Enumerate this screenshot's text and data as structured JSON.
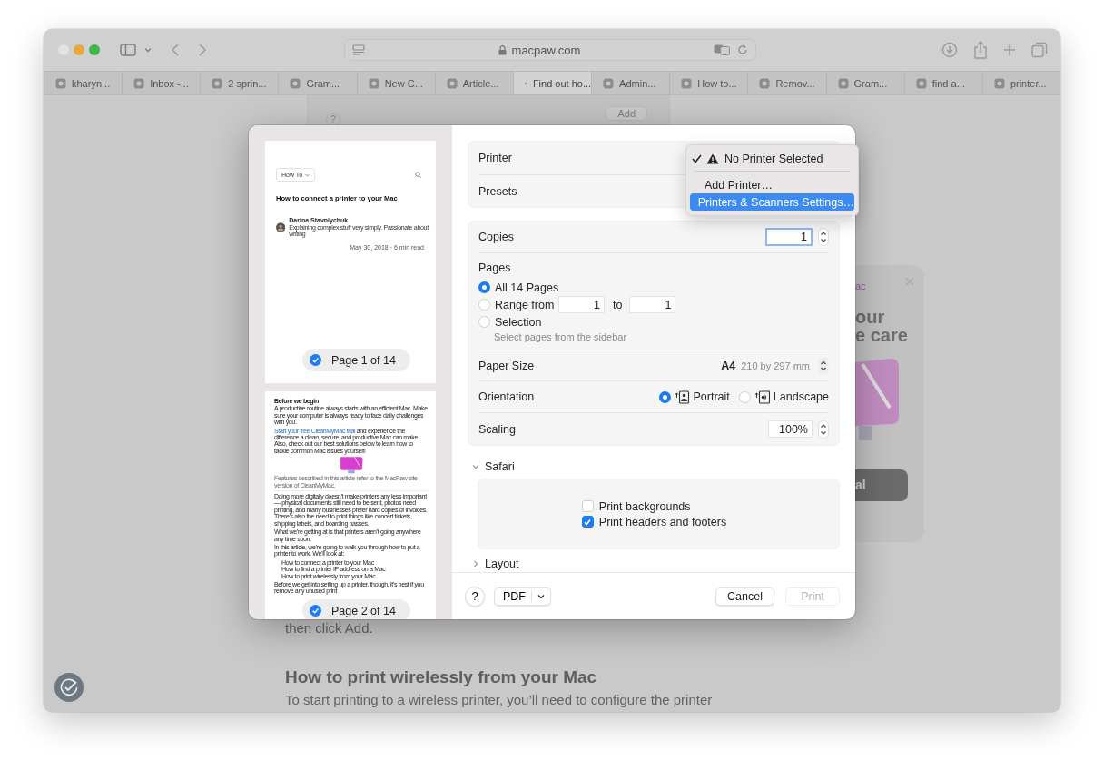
{
  "browser": {
    "address": "macpaw.com",
    "tabs": [
      {
        "label": "kharyn...",
        "selected": false
      },
      {
        "label": "Inbox -...",
        "selected": false
      },
      {
        "label": "2 sprin...",
        "selected": false
      },
      {
        "label": "Gram...",
        "selected": false
      },
      {
        "label": "New C...",
        "selected": false
      },
      {
        "label": "Article...",
        "selected": false
      },
      {
        "label": "Find out ho...",
        "selected": true
      },
      {
        "label": "Admin...",
        "selected": false
      },
      {
        "label": "How to...",
        "selected": false
      },
      {
        "label": "Remov...",
        "selected": false
      },
      {
        "label": "Gram...",
        "selected": false
      },
      {
        "label": "find a...",
        "selected": false
      },
      {
        "label": "printer...",
        "selected": false
      }
    ]
  },
  "background_page": {
    "sheet_help": "?",
    "sheet_button": "Add",
    "promo": {
      "label": "ac",
      "title_lines": [
        "our",
        "e care"
      ],
      "button": "al"
    },
    "text": "then click Add.",
    "heading": "How to print wirelessly from your Mac",
    "paragraph": "To start printing to a wireless printer, you’ll need to configure the printer"
  },
  "print_dialog": {
    "previews": [
      {
        "kind": "cover",
        "selected": true,
        "page_label": "Page 1 of 14",
        "nav_label": "How To",
        "title": "How to connect a printer to your Mac",
        "author": "Darina Stavniychuk",
        "bio": "Explaining complex stuff very simply. Passionate about writing",
        "date": "May 30, 2018 · 6 min read"
      },
      {
        "kind": "body",
        "selected": true,
        "page_label": "Page 2 of 14",
        "blocks": [
          {
            "kind": "heading",
            "text": "Before we begin"
          },
          {
            "kind": "text",
            "text": "A productive routine always starts with an efficient Mac. Make sure your computer is always ready to face daily challenges with you."
          },
          {
            "kind": "link_text",
            "link": "Start your free CleanMyMac trial",
            "text": " and experience the difference a clean, secure, and productive Mac can make. Also, check out our best solutions below to learn how to tackle common Mac issues yourself!"
          },
          {
            "kind": "illustration"
          },
          {
            "kind": "note",
            "text": "Features described in this article refer to the MacPaw site version of CleanMyMac."
          },
          {
            "kind": "text",
            "text": "Doing more digitally doesn’t make printers any less important — physical documents still need to be sent, photos need printing, and many businesses prefer hard copies of invoices. There’s also the need to print things like concert tickets, shipping labels, and boarding passes."
          },
          {
            "kind": "text",
            "text": "What we’re getting at is that printers aren’t going anywhere any time soon."
          },
          {
            "kind": "text",
            "text": "In this article, we’re going to walk you through how to put a printer to work. We’ll look at:"
          },
          {
            "kind": "list",
            "items": [
              "How to connect a printer to your Mac",
              "How to find a printer IP address on a Mac",
              "How to print wirelessly from your Mac"
            ]
          },
          {
            "kind": "text",
            "text": "Before we get into setting up a printer, though, it’s best if you remove any unused print"
          }
        ]
      }
    ],
    "printer_label": "Printer",
    "presets_label": "Presets",
    "printer_menu": [
      {
        "label": "No Printer Selected",
        "checked": true,
        "warning": true,
        "selected": false
      },
      {
        "label": "Add Printer…",
        "checked": false,
        "warning": false,
        "selected": false
      },
      {
        "label": "Printers & Scanners Settings…",
        "checked": false,
        "warning": false,
        "selected": true
      }
    ],
    "copies": {
      "label": "Copies",
      "value": "1"
    },
    "pages": {
      "label": "Pages",
      "options": [
        {
          "kind": "all",
          "label": "All 14 Pages",
          "selected": true
        },
        {
          "kind": "range",
          "label": "Range from",
          "selected": false,
          "from": "1",
          "to_label": "to",
          "to": "1"
        },
        {
          "kind": "selection",
          "label": "Selection",
          "selected": false,
          "hint": "Select pages from the sidebar"
        }
      ]
    },
    "paper_size": {
      "label": "Paper Size",
      "value": "A4",
      "detail": "210 by 297 mm"
    },
    "orientation": {
      "label": "Orientation",
      "options": [
        {
          "kind": "portrait",
          "label": "Portrait",
          "selected": true
        },
        {
          "kind": "landscape",
          "label": "Landscape",
          "selected": false
        }
      ]
    },
    "scaling": {
      "label": "Scaling",
      "value": "100%"
    },
    "sections": [
      {
        "title": "Safari",
        "expanded": true,
        "options": [
          {
            "label": "Print backgrounds",
            "checked": false
          },
          {
            "label": "Print headers and footers",
            "checked": true
          }
        ]
      },
      {
        "title": "Layout",
        "expanded": false
      }
    ],
    "help": "?",
    "pdf": "PDF",
    "buttons": [
      {
        "label": "Cancel",
        "disabled": false
      },
      {
        "label": "Print",
        "disabled": true
      }
    ]
  }
}
